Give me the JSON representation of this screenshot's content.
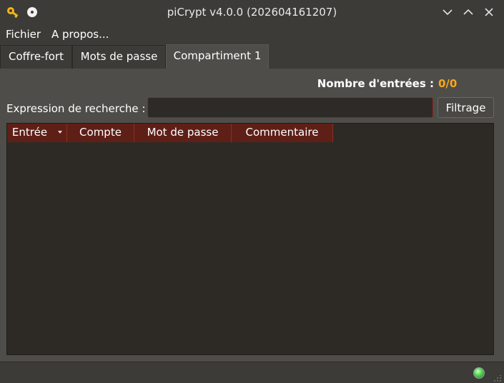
{
  "window": {
    "title": "piCrypt v4.0.0 (202604161207)",
    "icons": [
      "key-icon",
      "dot-icon"
    ],
    "controls": [
      "minimize-icon",
      "maximize-icon",
      "close-icon"
    ]
  },
  "menu": {
    "items": [
      {
        "label": "Fichier"
      },
      {
        "label": "A propos..."
      }
    ]
  },
  "tabs": [
    {
      "label": "Coffre-fort",
      "active": false
    },
    {
      "label": "Mots de passe",
      "active": false
    },
    {
      "label": "Compartiment 1",
      "active": true
    }
  ],
  "panel": {
    "count_label": "Nombre d'entrées :",
    "count_value": "0/0",
    "search_label": "Expression de recherche :",
    "search_value": "",
    "filter_button": "Filtrage"
  },
  "table": {
    "columns": [
      {
        "label": "Entrée",
        "sorted": true
      },
      {
        "label": "Compte",
        "sorted": false
      },
      {
        "label": "Mot de passe",
        "sorted": false
      },
      {
        "label": "Commentaire",
        "sorted": false
      }
    ],
    "rows": []
  },
  "status": {
    "indicator": "green-status-icon"
  },
  "colors": {
    "accent": "#f7a81c",
    "header_bg": "#5e1f17",
    "input_border": "#8b2a1c",
    "status_led": "#4fd04f"
  }
}
